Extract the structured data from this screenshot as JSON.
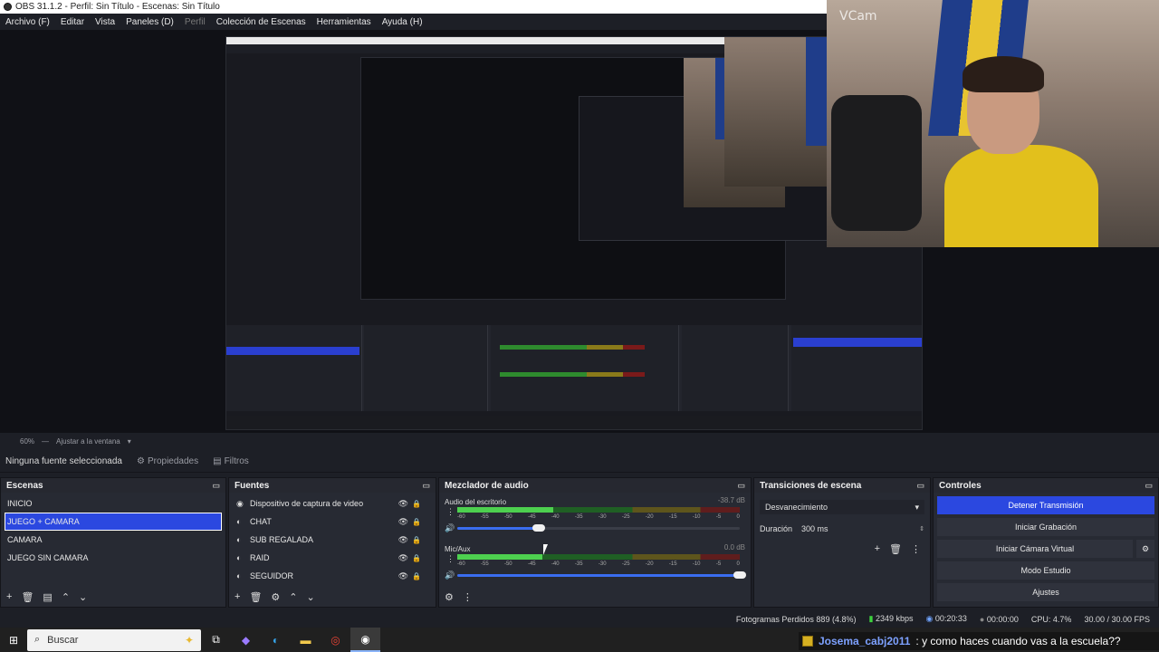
{
  "window": {
    "title": "OBS 31.1.2 - Perfil: Sin Título - Escenas: Sin Título"
  },
  "menu": [
    {
      "label": "Archivo (F)",
      "enabled": true
    },
    {
      "label": "Editar",
      "enabled": true
    },
    {
      "label": "Vista",
      "enabled": true
    },
    {
      "label": "Paneles (D)",
      "enabled": true
    },
    {
      "label": "Perfil",
      "enabled": false
    },
    {
      "label": "Colección de Escenas",
      "enabled": true
    },
    {
      "label": "Herramientas",
      "enabled": true
    },
    {
      "label": "Ayuda (H)",
      "enabled": true
    }
  ],
  "preview": {
    "webcam_label": "VCam"
  },
  "zoom": {
    "percent": "60%",
    "fit_label": "Ajustar a la ventana"
  },
  "propsbar": {
    "no_source": "Ninguna fuente seleccionada",
    "properties": "Propiedades",
    "filters": "Filtros"
  },
  "scenes": {
    "title": "Escenas",
    "items": [
      "INICIO",
      "JUEGO + CAMARA",
      "CAMARA",
      "JUEGO SIN CAMARA"
    ],
    "selected": "JUEGO + CAMARA"
  },
  "sources": {
    "title": "Fuentes",
    "items": [
      "Dispositivo de captura de video",
      "CHAT",
      "SUB REGALADA",
      "RAID",
      "SEGUIDOR"
    ]
  },
  "mixer": {
    "title": "Mezclador de audio",
    "channels": [
      {
        "name": "Audio del escritorio",
        "db": "-38.7 dB",
        "level": 0.34,
        "volume": 0.29
      },
      {
        "name": "Mic/Aux",
        "db": "0.0 dB",
        "level": 0.3,
        "volume": 1.0
      }
    ],
    "ticks": [
      "-60",
      "-55",
      "-50",
      "-45",
      "-40",
      "-35",
      "-30",
      "-25",
      "-20",
      "-15",
      "-10",
      "-5",
      "0"
    ]
  },
  "transitions": {
    "title": "Transiciones de escena",
    "selected": "Desvanecimiento",
    "duration_label": "Duración",
    "duration_value": "300 ms"
  },
  "controls": {
    "title": "Controles",
    "stop_stream": "Detener Transmisión",
    "start_recording": "Iniciar Grabación",
    "start_virtual_cam": "Iniciar Cámara Virtual",
    "studio_mode": "Modo Estudio",
    "settings": "Ajustes"
  },
  "status": {
    "dropped": "Fotogramas Perdidos 889 (4.8%)",
    "bitrate": "2349 kbps",
    "stream_time": "00:20:33",
    "rec_time": "00:00:00",
    "cpu": "CPU: 4.7%",
    "fps": "30.00 / 30.00 FPS"
  },
  "taskbar": {
    "search_placeholder": "Buscar"
  },
  "chat": {
    "user": "Josema_cabj2011",
    "message": ": y como haces cuando vas a la escuela??"
  },
  "colors": {
    "accent": "#2b48e0",
    "panel": "#272a33",
    "meter_green": "#4dd04f"
  }
}
